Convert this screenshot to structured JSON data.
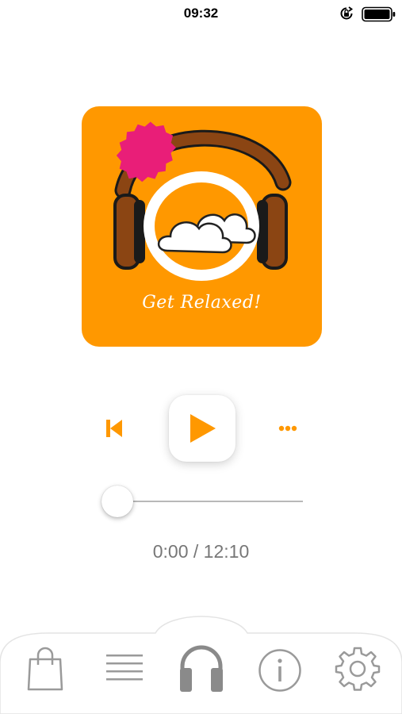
{
  "status_bar": {
    "time": "09:32",
    "icons": [
      "rotation-lock-icon",
      "battery-icon"
    ]
  },
  "cover": {
    "title": "Get Relaxed!",
    "colors": {
      "background": "#ff9800",
      "starburst": "#e91e78",
      "headphone_band": "#8b4513"
    }
  },
  "player": {
    "icons": {
      "previous": "skip-previous-icon",
      "play": "play-icon",
      "more": "more-icon"
    },
    "accent_color": "#ff9800",
    "progress": 0,
    "elapsed": "0:00",
    "separator": "/",
    "duration": "12:10",
    "time_text": "0:00 / 12:10"
  },
  "tab_bar": {
    "tabs": [
      {
        "icon": "shopping-bag-icon",
        "active": false
      },
      {
        "icon": "list-icon",
        "active": false
      },
      {
        "icon": "headphones-icon",
        "active": true
      },
      {
        "icon": "info-icon",
        "active": false
      },
      {
        "icon": "settings-gear-icon",
        "active": false
      }
    ]
  }
}
